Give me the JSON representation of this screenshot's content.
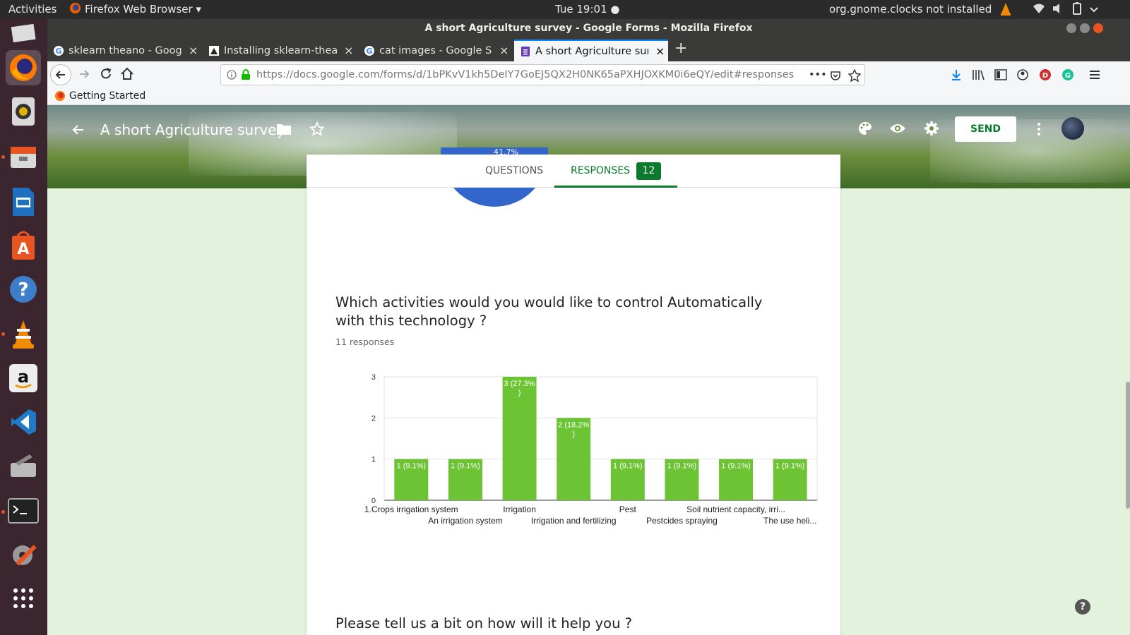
{
  "topbar": {
    "activities": "Activities",
    "app_menu": "Firefox Web Browser ▾",
    "clock": "Tue 19:01 ●",
    "notice": "org.gnome.clocks not installed"
  },
  "window": {
    "title": "A short Agriculture survey - Google Forms - Mozilla Firefox"
  },
  "tabs": [
    {
      "label": "sklearn theano - Google S",
      "close": "×"
    },
    {
      "label": "Installing sklearn-theano",
      "close": "×"
    },
    {
      "label": "cat images - Google Sear",
      "close": "×"
    },
    {
      "label": "A short Agriculture surve",
      "close": "×"
    }
  ],
  "new_tab": "+",
  "url": "https://docs.google.com/forms/d/1bPKvV1kh5DeIY7GoEJ5QX2H0NK65aPXHJOXKM0i6eQY/edit#responses",
  "url_more": "•••",
  "bookmarks": {
    "getting_started": "Getting Started"
  },
  "form": {
    "title": "A short Agriculture survey",
    "send_label": "SEND",
    "tab_questions": "QUESTIONS",
    "tab_responses": "RESPONSES",
    "response_count": "12",
    "pie_pct": "41.7%",
    "question": "Which activities would you would like to control Automatically with this technology ?",
    "responses_text": "11 responses",
    "next_question": "Please tell us a bit on how will it help you ?"
  },
  "colors": {
    "bar": "#6cc334",
    "accent": "#0a7a2c",
    "pie": "#3366cc"
  },
  "chart_data": {
    "type": "bar",
    "categories": [
      "1.Crops irrigation system",
      "An irrigation system",
      "Irrigation",
      "Irrigation and fertilizing",
      "Pest",
      "Pestcides spraying",
      "Soil nutrient capacity, irri...",
      "The use heli..."
    ],
    "values": [
      1,
      1,
      3,
      2,
      1,
      1,
      1,
      1
    ],
    "data_labels": [
      "1 (9.1%)",
      "1 (9.1%)",
      "3 (27.3%)",
      "2 (18.2%)",
      "1 (9.1%)",
      "1 (9.1%)",
      "1 (9.1%)",
      "1 (9.1%)"
    ],
    "yticks": [
      "0",
      "1",
      "2",
      "3"
    ],
    "ylim": [
      0,
      3
    ],
    "grid": true
  }
}
